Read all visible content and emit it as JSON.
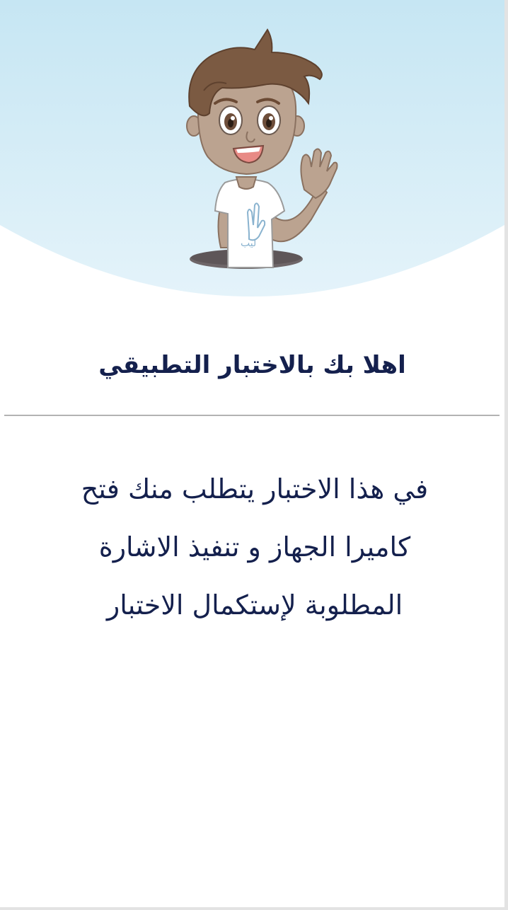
{
  "welcome": {
    "title": "اهلا بك بالاختبار التطبيقي",
    "instructions": [
      "في هذا الاختبار يتطلب منك فتح",
      "كاميرا الجهاز و تنفيذ الاشارة",
      "المطلوبة لإستكمال الاختبار"
    ]
  },
  "illustration": {
    "name": "boy-waving-icon",
    "shirt_logo_text": "ليب"
  },
  "colors": {
    "header_sky_top": "#c6e6f3",
    "header_sky_bottom": "#e2f2f9",
    "text_dark_navy": "#14204d",
    "divider": "#b3b3b3",
    "background": "#ffffff"
  }
}
